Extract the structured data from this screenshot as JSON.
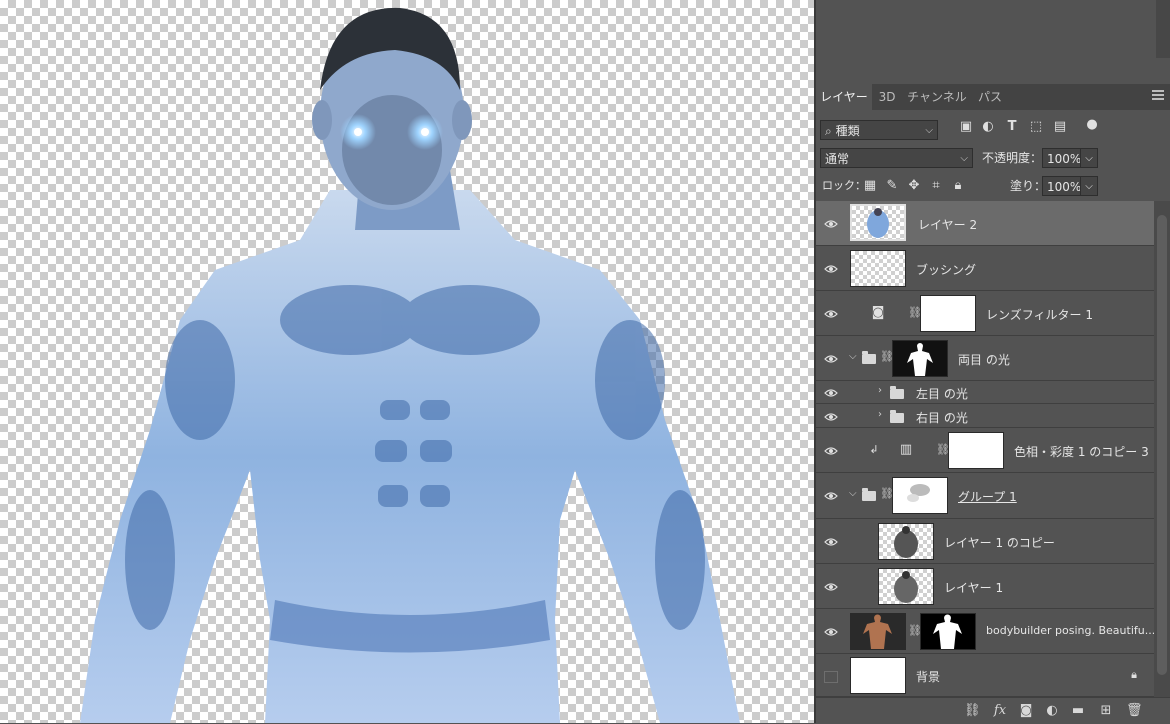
{
  "tabs": [
    {
      "label": "レイヤー",
      "active": true
    },
    {
      "label": "3D",
      "active": false
    },
    {
      "label": "チャンネル",
      "active": false
    },
    {
      "label": "パス",
      "active": false
    }
  ],
  "filter": {
    "kind_label": "種類"
  },
  "blend": {
    "mode": "通常",
    "opacity_label": "不透明度：",
    "opacity": "100%"
  },
  "lock": {
    "label": "ロック：",
    "fill_label": "塗り：",
    "fill": "100%"
  },
  "layers": [
    {
      "name": "レイヤー 2",
      "selected": true
    },
    {
      "name": "ブッシング"
    },
    {
      "name": "レンズフィルター 1"
    },
    {
      "name": "両目 の光"
    },
    {
      "name": "左目 の光"
    },
    {
      "name": "右目 の光"
    },
    {
      "name": "色相・彩度 1 のコピー 3"
    },
    {
      "name": "グループ 1"
    },
    {
      "name": "レイヤー 1 のコピー"
    },
    {
      "name": "レイヤー 1"
    },
    {
      "name": "bodybuilder posing. Beautifu..."
    },
    {
      "name": "背景"
    }
  ],
  "icons": [
    "search-icon",
    "eye-icon",
    "folder-icon",
    "chain-icon",
    "lock-icon",
    "camera-icon",
    "adjustment-icon",
    "link-icon",
    "fx-icon",
    "mask-icon",
    "new-fill-icon",
    "new-group-icon",
    "new-layer-icon",
    "trash-icon"
  ]
}
